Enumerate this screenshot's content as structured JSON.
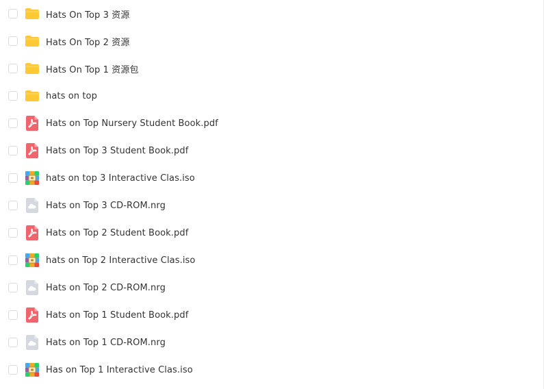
{
  "files": [
    {
      "name": "Hats On Top 3 资源",
      "icon": "folder-icon"
    },
    {
      "name": "Hats On Top 2 资源",
      "icon": "folder-icon"
    },
    {
      "name": "Hats On Top 1 资源包",
      "icon": "folder-icon"
    },
    {
      "name": "hats on top",
      "icon": "folder-icon"
    },
    {
      "name": "Hats on Top Nursery Student Book.pdf",
      "icon": "pdf-icon"
    },
    {
      "name": "Hats on Top 3 Student Book.pdf",
      "icon": "pdf-icon"
    },
    {
      "name": "hats on top 3 Interactive Clas.iso",
      "icon": "archive-icon"
    },
    {
      "name": "Hats on Top 3 CD-ROM.nrg",
      "icon": "cloud-file-icon"
    },
    {
      "name": "Hats on Top 2 Student Book.pdf",
      "icon": "pdf-icon"
    },
    {
      "name": "hats on Top 2 Interactive Clas.iso",
      "icon": "archive-icon"
    },
    {
      "name": "Hats on Top 2 CD-ROM.nrg",
      "icon": "cloud-file-icon"
    },
    {
      "name": "Hats on Top 1 Student Book.pdf",
      "icon": "pdf-icon"
    },
    {
      "name": "Hats on Top 1 CD-ROM.nrg",
      "icon": "cloud-file-icon"
    },
    {
      "name": "Has on Top 1 Interactive Clas.iso",
      "icon": "archive-icon"
    }
  ],
  "colors": {
    "folder": "#ffc933",
    "pdf": "#f0646c",
    "cloud": "#d5d8de"
  }
}
